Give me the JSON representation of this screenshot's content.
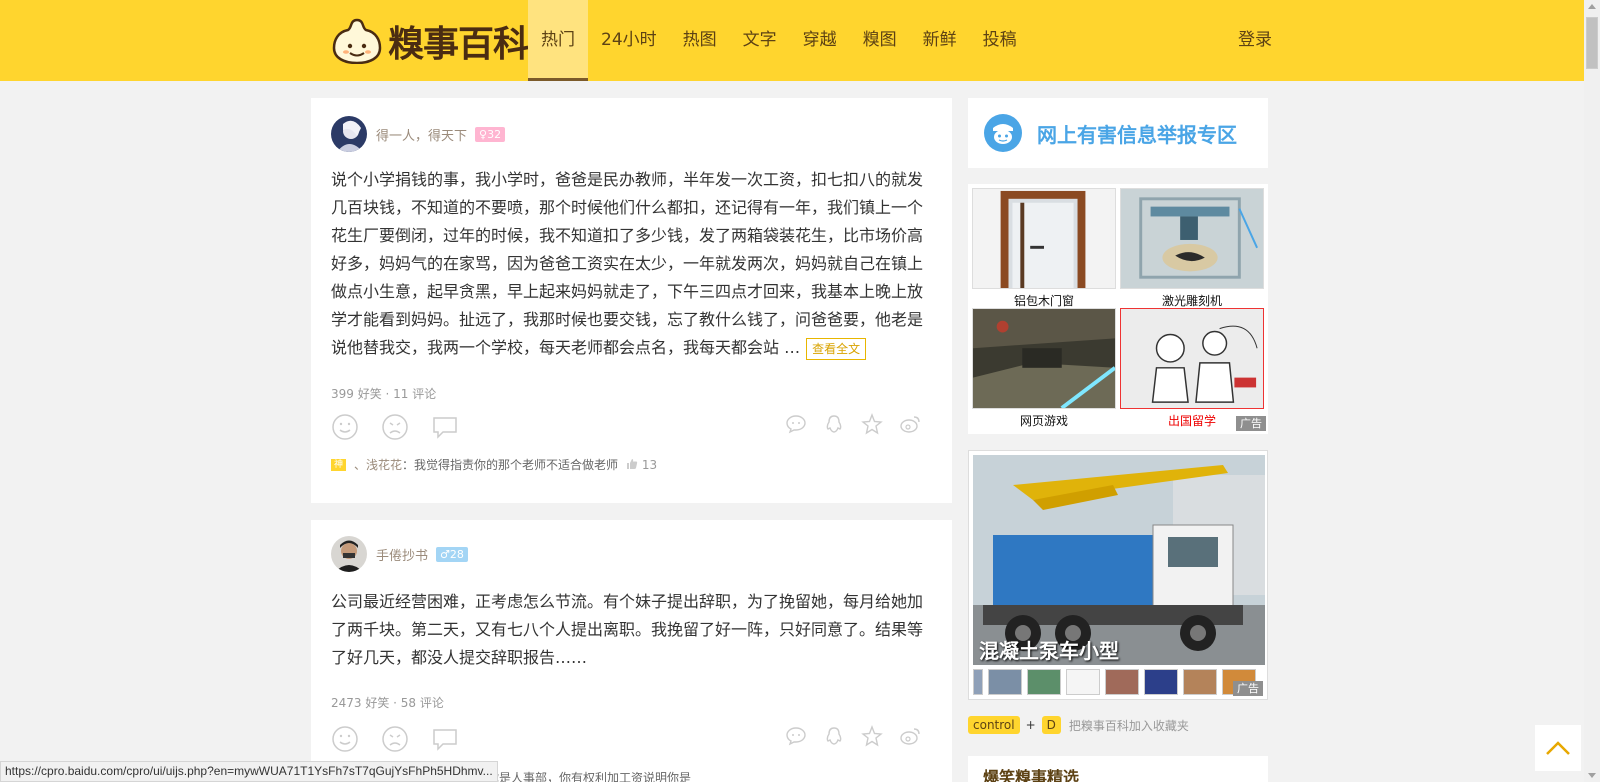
{
  "header": {
    "brand": "糗事百科",
    "nav": [
      "热门",
      "24小时",
      "热图",
      "文字",
      "穿越",
      "糗图",
      "新鲜",
      "投稿"
    ],
    "active_index": 0,
    "login": "登录"
  },
  "posts": [
    {
      "author": "得一人，得天下",
      "gender": "female",
      "age": "32",
      "content": "说个小学捐钱的事，我小学时，爸爸是民办教师，半年发一次工资，扣七扣八的就发几百块钱，不知道的不要喷，那个时候他们什么都扣，还记得有一年，我们镇上一个花生厂要倒闭，过年的时候，我不知道扣了多少钱，发了两箱袋装花生，比市场价高好多，妈妈气的在家骂，因为爸爸工资实在太少，一年就发两次，妈妈就自己在镇上做点小生意，起早贪黑，早上起来妈妈就走了，下午三四点才回来，我基本上晚上放学才能看到妈妈。扯远了，我那时候也要交钱，忘了教什么钱了，问爸爸要，他老是说他替我交，我两一个学校，每天老师都会点名，我每天都会站 …",
      "read_more": "查看全文",
      "stats": "399 好笑 · 11 评论",
      "hot_label": "神",
      "commenter": "、浅花花",
      "comment": "：我觉得指责你的那个老师不适合做老师",
      "comment_likes": "13"
    },
    {
      "author": "手倦抄书",
      "gender": "male",
      "age": "28",
      "content": "公司最近经营困难，正考虑怎么节流。有个妹子提出辞职，为了挽留她，每月给她加了两千块。第二天，又有七八个人提出离职。我挽留了好一阵，只好同意了。结果等了好几天，都没人提交辞职报告……",
      "stats": "2473 好笑 · 58 评论",
      "partial_comment": "…是洞，辞职要你同意，说明你是人事部，你有权利加工资说明你是"
    }
  ],
  "sidebar": {
    "report": "网上有害信息举报专区",
    "ad_grid": [
      {
        "caption": "铝包木门窗",
        "highlight": false
      },
      {
        "caption": "激光雕刻机",
        "highlight": false
      },
      {
        "caption": "网页游戏",
        "highlight": false
      },
      {
        "caption": "出国留学",
        "highlight": true
      }
    ],
    "ad_label": "广告",
    "big_ad_title": "混凝土泵车小型",
    "favorite": {
      "key1": "control",
      "plus": "+",
      "key2": "D",
      "text": "把糗事百科加入收藏夹"
    },
    "featured_title": "爆笑糗事精选"
  },
  "status_url": "https://cpro.baidu.com/cpro/ui/uijs.php?en=mywWUA71T1YsFh7sT7qGujYsFhPh5HDhmv...",
  "colors": {
    "header": "#ffd52e",
    "accent": "#4aa5e6",
    "brown": "#5d4214"
  }
}
